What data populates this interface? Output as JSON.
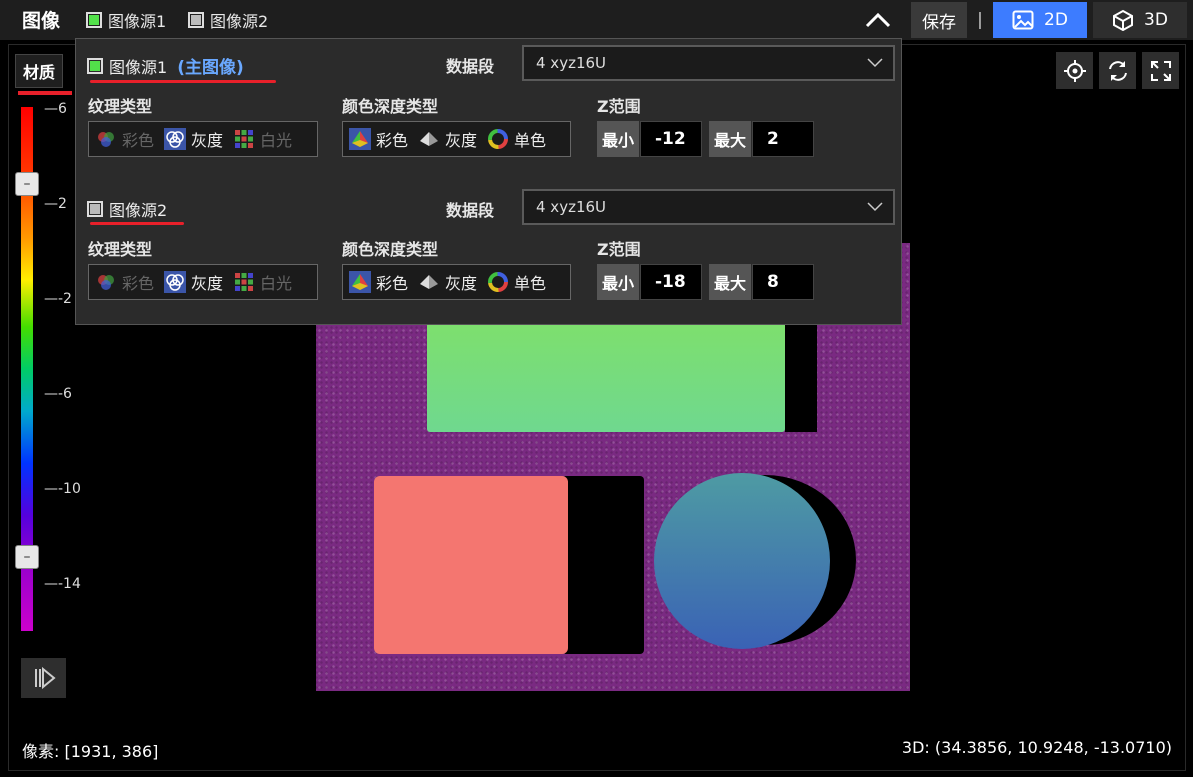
{
  "topbar": {
    "title": "图像",
    "source1_label": "图像源1",
    "source2_label": "图像源2",
    "save_label": "保存",
    "separator": "|",
    "view2d_label": "2D",
    "view3d_label": "3D"
  },
  "material_label": "材质",
  "colorbar": {
    "ticks": [
      "6",
      "2",
      "-2",
      "-6",
      "-10",
      "-14"
    ]
  },
  "panel": {
    "source1": {
      "label": "图像源1",
      "primary_tag": "(主图像)",
      "data_segment_label": "数据段",
      "data_segment_value": "4 xyz16U",
      "texture_label": "纹理类型",
      "texture_options": [
        "彩色",
        "灰度",
        "白光"
      ],
      "depth_label": "颜色深度类型",
      "depth_options": [
        "彩色",
        "灰度",
        "单色"
      ],
      "z_label": "Z范围",
      "z_min_label": "最小",
      "z_min": "-12",
      "z_max_label": "最大",
      "z_max": "2"
    },
    "source2": {
      "label": "图像源2",
      "data_segment_label": "数据段",
      "data_segment_value": "4 xyz16U",
      "texture_label": "纹理类型",
      "texture_options": [
        "彩色",
        "灰度",
        "白光"
      ],
      "depth_label": "颜色深度类型",
      "depth_options": [
        "彩色",
        "灰度",
        "单色"
      ],
      "z_label": "Z范围",
      "z_min_label": "最小",
      "z_min": "-18",
      "z_max_label": "最大",
      "z_max": "8"
    }
  },
  "status": {
    "pixel": "像素: [1931, 386]",
    "coord3d": "3D: (34.3856, 10.9248, -13.0710)"
  },
  "colors": {
    "accent_blue": "#3d7cff",
    "checkbox_green": "#52e04a",
    "underline_red": "#e8202a",
    "primary_tag_blue": "#6aa8ff"
  }
}
